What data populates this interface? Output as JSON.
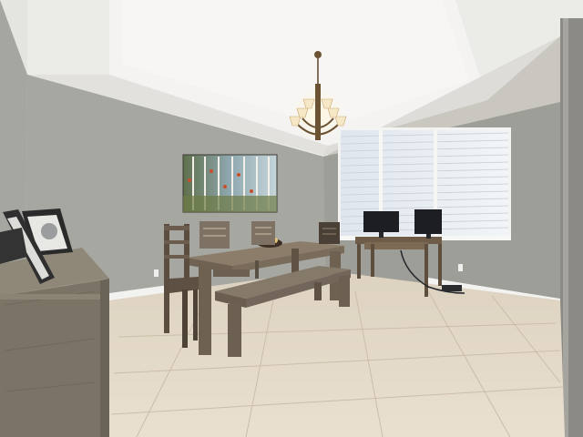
{
  "scene": {
    "colors": {
      "ceiling": "#eeeeec",
      "tray_ceiling": "#f4f3f1",
      "wall_left": "#a3a39e",
      "wall_back": "#a6a6a0",
      "wall_right": "#9d9d97",
      "floor": "#e4d8c6",
      "grout": "#cdbfae",
      "baseboard": "#f2f2f0",
      "wood_table": "#8c7d6a",
      "wood_dark": "#5a4d40",
      "sideboard": "#8e8778",
      "window_light": "#e9eef3",
      "monitor": "#1c1e22",
      "chandelier_brass": "#6b5232",
      "lamp_shade": "#f6e8c7"
    },
    "objects": [
      "tray-ceiling",
      "chandelier",
      "birch-tree-painting",
      "window-with-blinds",
      "desk-with-two-monitors",
      "dining-table",
      "dining-bench",
      "dining-chairs",
      "fruit-bowl",
      "sideboard",
      "picture-frames",
      "tile-floor",
      "wall-outlet"
    ]
  }
}
